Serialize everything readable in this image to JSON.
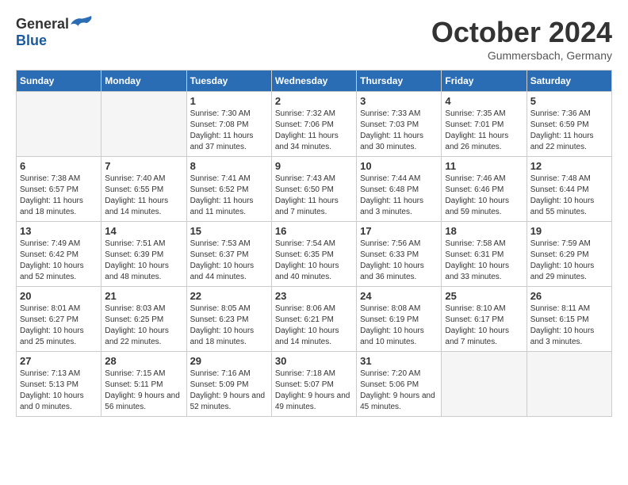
{
  "header": {
    "logo_general": "General",
    "logo_blue": "Blue",
    "title": "October 2024",
    "subtitle": "Gummersbach, Germany"
  },
  "days_of_week": [
    "Sunday",
    "Monday",
    "Tuesday",
    "Wednesday",
    "Thursday",
    "Friday",
    "Saturday"
  ],
  "weeks": [
    [
      {
        "day": "",
        "empty": true
      },
      {
        "day": "",
        "empty": true
      },
      {
        "day": "1",
        "sunrise": "7:30 AM",
        "sunset": "7:08 PM",
        "daylight": "11 hours and 37 minutes."
      },
      {
        "day": "2",
        "sunrise": "7:32 AM",
        "sunset": "7:06 PM",
        "daylight": "11 hours and 34 minutes."
      },
      {
        "day": "3",
        "sunrise": "7:33 AM",
        "sunset": "7:03 PM",
        "daylight": "11 hours and 30 minutes."
      },
      {
        "day": "4",
        "sunrise": "7:35 AM",
        "sunset": "7:01 PM",
        "daylight": "11 hours and 26 minutes."
      },
      {
        "day": "5",
        "sunrise": "7:36 AM",
        "sunset": "6:59 PM",
        "daylight": "11 hours and 22 minutes."
      }
    ],
    [
      {
        "day": "6",
        "sunrise": "7:38 AM",
        "sunset": "6:57 PM",
        "daylight": "11 hours and 18 minutes."
      },
      {
        "day": "7",
        "sunrise": "7:40 AM",
        "sunset": "6:55 PM",
        "daylight": "11 hours and 14 minutes."
      },
      {
        "day": "8",
        "sunrise": "7:41 AM",
        "sunset": "6:52 PM",
        "daylight": "11 hours and 11 minutes."
      },
      {
        "day": "9",
        "sunrise": "7:43 AM",
        "sunset": "6:50 PM",
        "daylight": "11 hours and 7 minutes."
      },
      {
        "day": "10",
        "sunrise": "7:44 AM",
        "sunset": "6:48 PM",
        "daylight": "11 hours and 3 minutes."
      },
      {
        "day": "11",
        "sunrise": "7:46 AM",
        "sunset": "6:46 PM",
        "daylight": "10 hours and 59 minutes."
      },
      {
        "day": "12",
        "sunrise": "7:48 AM",
        "sunset": "6:44 PM",
        "daylight": "10 hours and 55 minutes."
      }
    ],
    [
      {
        "day": "13",
        "sunrise": "7:49 AM",
        "sunset": "6:42 PM",
        "daylight": "10 hours and 52 minutes."
      },
      {
        "day": "14",
        "sunrise": "7:51 AM",
        "sunset": "6:39 PM",
        "daylight": "10 hours and 48 minutes."
      },
      {
        "day": "15",
        "sunrise": "7:53 AM",
        "sunset": "6:37 PM",
        "daylight": "10 hours and 44 minutes."
      },
      {
        "day": "16",
        "sunrise": "7:54 AM",
        "sunset": "6:35 PM",
        "daylight": "10 hours and 40 minutes."
      },
      {
        "day": "17",
        "sunrise": "7:56 AM",
        "sunset": "6:33 PM",
        "daylight": "10 hours and 36 minutes."
      },
      {
        "day": "18",
        "sunrise": "7:58 AM",
        "sunset": "6:31 PM",
        "daylight": "10 hours and 33 minutes."
      },
      {
        "day": "19",
        "sunrise": "7:59 AM",
        "sunset": "6:29 PM",
        "daylight": "10 hours and 29 minutes."
      }
    ],
    [
      {
        "day": "20",
        "sunrise": "8:01 AM",
        "sunset": "6:27 PM",
        "daylight": "10 hours and 25 minutes."
      },
      {
        "day": "21",
        "sunrise": "8:03 AM",
        "sunset": "6:25 PM",
        "daylight": "10 hours and 22 minutes."
      },
      {
        "day": "22",
        "sunrise": "8:05 AM",
        "sunset": "6:23 PM",
        "daylight": "10 hours and 18 minutes."
      },
      {
        "day": "23",
        "sunrise": "8:06 AM",
        "sunset": "6:21 PM",
        "daylight": "10 hours and 14 minutes."
      },
      {
        "day": "24",
        "sunrise": "8:08 AM",
        "sunset": "6:19 PM",
        "daylight": "10 hours and 10 minutes."
      },
      {
        "day": "25",
        "sunrise": "8:10 AM",
        "sunset": "6:17 PM",
        "daylight": "10 hours and 7 minutes."
      },
      {
        "day": "26",
        "sunrise": "8:11 AM",
        "sunset": "6:15 PM",
        "daylight": "10 hours and 3 minutes."
      }
    ],
    [
      {
        "day": "27",
        "sunrise": "7:13 AM",
        "sunset": "5:13 PM",
        "daylight": "10 hours and 0 minutes."
      },
      {
        "day": "28",
        "sunrise": "7:15 AM",
        "sunset": "5:11 PM",
        "daylight": "9 hours and 56 minutes."
      },
      {
        "day": "29",
        "sunrise": "7:16 AM",
        "sunset": "5:09 PM",
        "daylight": "9 hours and 52 minutes."
      },
      {
        "day": "30",
        "sunrise": "7:18 AM",
        "sunset": "5:07 PM",
        "daylight": "9 hours and 49 minutes."
      },
      {
        "day": "31",
        "sunrise": "7:20 AM",
        "sunset": "5:06 PM",
        "daylight": "9 hours and 45 minutes."
      },
      {
        "day": "",
        "empty": true
      },
      {
        "day": "",
        "empty": true
      }
    ]
  ]
}
